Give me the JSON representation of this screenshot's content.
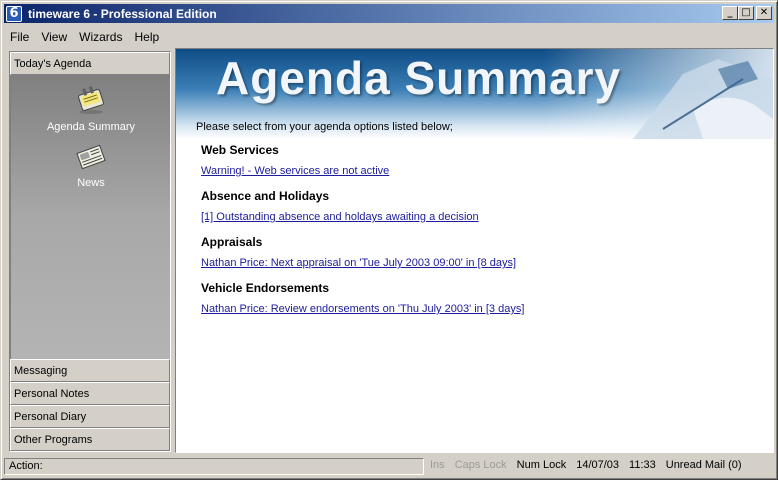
{
  "window": {
    "title": "timeware 6 - Professional Edition",
    "icon_text": "6",
    "minimize": "_",
    "maximize": "□",
    "close": "✕"
  },
  "menu": [
    "File",
    "View",
    "Wizards",
    "Help"
  ],
  "sidebar": {
    "active_group": "Today's Agenda",
    "items": [
      {
        "label": "Agenda Summary",
        "icon": "agenda-icon"
      },
      {
        "label": "News",
        "icon": "news-icon"
      }
    ],
    "groups": [
      "Messaging",
      "Personal Notes",
      "Personal Diary",
      "Other Programs"
    ]
  },
  "main": {
    "banner_title": "Agenda Summary",
    "intro": "Please select from your agenda options listed below;",
    "sections": [
      {
        "title": "Web Services",
        "link": "Warning! - Web services are not active"
      },
      {
        "title": "Absence and Holidays",
        "link": "[1] Outstanding absence and holdays awaiting a decision"
      },
      {
        "title": "Appraisals",
        "link": "Nathan  Price:  Next appraisal on 'Tue July 2003 09:00' in [8 days]"
      },
      {
        "title": "Vehicle Endorsements",
        "link": "Nathan  Price:  Review endorsements on 'Thu July 2003' in [3 days]"
      }
    ]
  },
  "status": {
    "action_label": "Action:",
    "ins": "Ins",
    "caps": "Caps Lock",
    "num": "Num Lock",
    "date": "14/07/03",
    "time": "11:33",
    "mail": "Unread Mail (0)"
  },
  "colors": {
    "titlebar_start": "#0a246a",
    "link": "#1c1c9c",
    "banner": "#1a5a96"
  }
}
